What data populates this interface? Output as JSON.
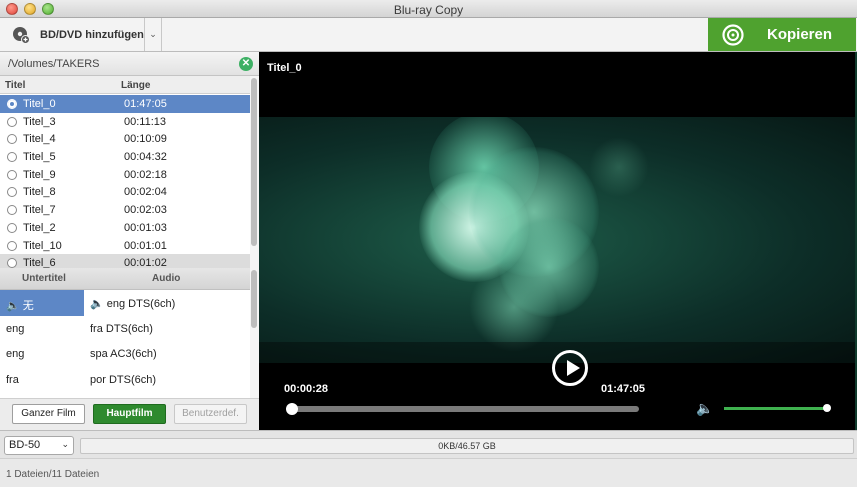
{
  "window": {
    "title": "Blu-ray Copy"
  },
  "toolbar": {
    "add_label": "BD/DVD hinzufügen",
    "copy_label": "Kopieren",
    "accent": "#4fa22f"
  },
  "left": {
    "path": "/Volumes/TAKERS",
    "col_title": "Titel",
    "col_length": "Länge",
    "titles": [
      {
        "name": "Titel_0",
        "length": "01:47:05",
        "selected": true
      },
      {
        "name": "Titel_3",
        "length": "00:11:13"
      },
      {
        "name": "Titel_4",
        "length": "00:10:09"
      },
      {
        "name": "Titel_5",
        "length": "00:04:32"
      },
      {
        "name": "Titel_9",
        "length": "00:02:18"
      },
      {
        "name": "Titel_8",
        "length": "00:02:04"
      },
      {
        "name": "Titel_7",
        "length": "00:02:03"
      },
      {
        "name": "Titel_2",
        "length": "00:01:03"
      },
      {
        "name": "Titel_10",
        "length": "00:01:01"
      },
      {
        "name": "Titel_6",
        "length": "00:01:02"
      }
    ],
    "subtitle_head": "Untertitel",
    "audio_head": "Audio",
    "subtitles": [
      "无",
      "eng",
      "eng",
      "fra"
    ],
    "audio": [
      "eng DTS(6ch)",
      "fra DTS(6ch)",
      "spa AC3(6ch)",
      "por DTS(6ch)"
    ],
    "btn_full": "Ganzer Film",
    "btn_main": "Hauptfilm",
    "btn_custom": "Benutzerdef."
  },
  "video": {
    "title": "Titel_0",
    "current": "00:00:28",
    "total": "01:47:05",
    "progress": 0.004,
    "volume": 1.0
  },
  "status": {
    "disc": "BD-50",
    "capacity": "0KB/46.57 GB",
    "footer": "1 Dateien/11 Dateien"
  }
}
